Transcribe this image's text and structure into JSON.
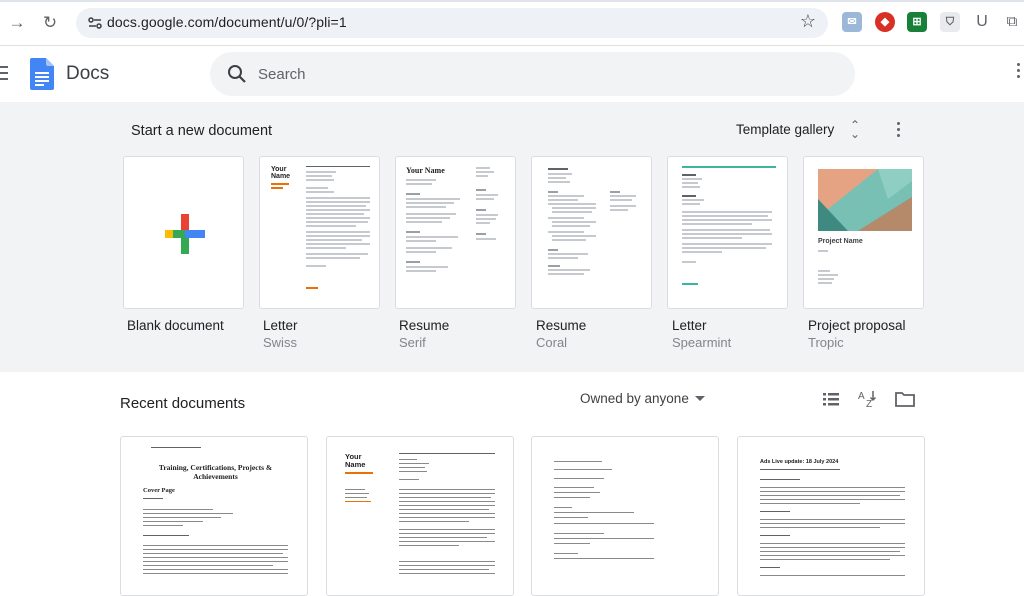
{
  "browser": {
    "url": "docs.google.com/document/u/0/?pli=1",
    "ext_u_label": "U"
  },
  "app": {
    "title": "Docs",
    "search_placeholder": "Search"
  },
  "templates": {
    "heading": "Start a new document",
    "gallery_label": "Template gallery",
    "items": [
      {
        "name": "Blank document",
        "sub": ""
      },
      {
        "name": "Letter",
        "sub": "Swiss"
      },
      {
        "name": "Resume",
        "sub": "Serif"
      },
      {
        "name": "Resume",
        "sub": "Coral"
      },
      {
        "name": "Letter",
        "sub": "Spearmint"
      },
      {
        "name": "Project proposal",
        "sub": "Tropic"
      }
    ],
    "thumb_text": {
      "swiss_name": "Your\nName",
      "serif_name": "Your Name",
      "tropic_name": "Project Name"
    }
  },
  "recent": {
    "heading": "Recent documents",
    "owner_filter": "Owned by anyone",
    "docs": [
      {
        "title_line": "Training, Certifications, Projects & Achievements",
        "sub": "Cover Page"
      },
      {
        "title_line": "Your\nName"
      },
      {
        "title_line": ""
      },
      {
        "title_line": "Ads Live update: 18 July 2024"
      }
    ]
  },
  "colors": {
    "accent_blue": "#4285f4",
    "accent_red": "#ea4335",
    "accent_yellow": "#fbbc04",
    "accent_green": "#34a853",
    "swiss_orange": "#e8710a",
    "spearmint": "#3cb4a0"
  }
}
